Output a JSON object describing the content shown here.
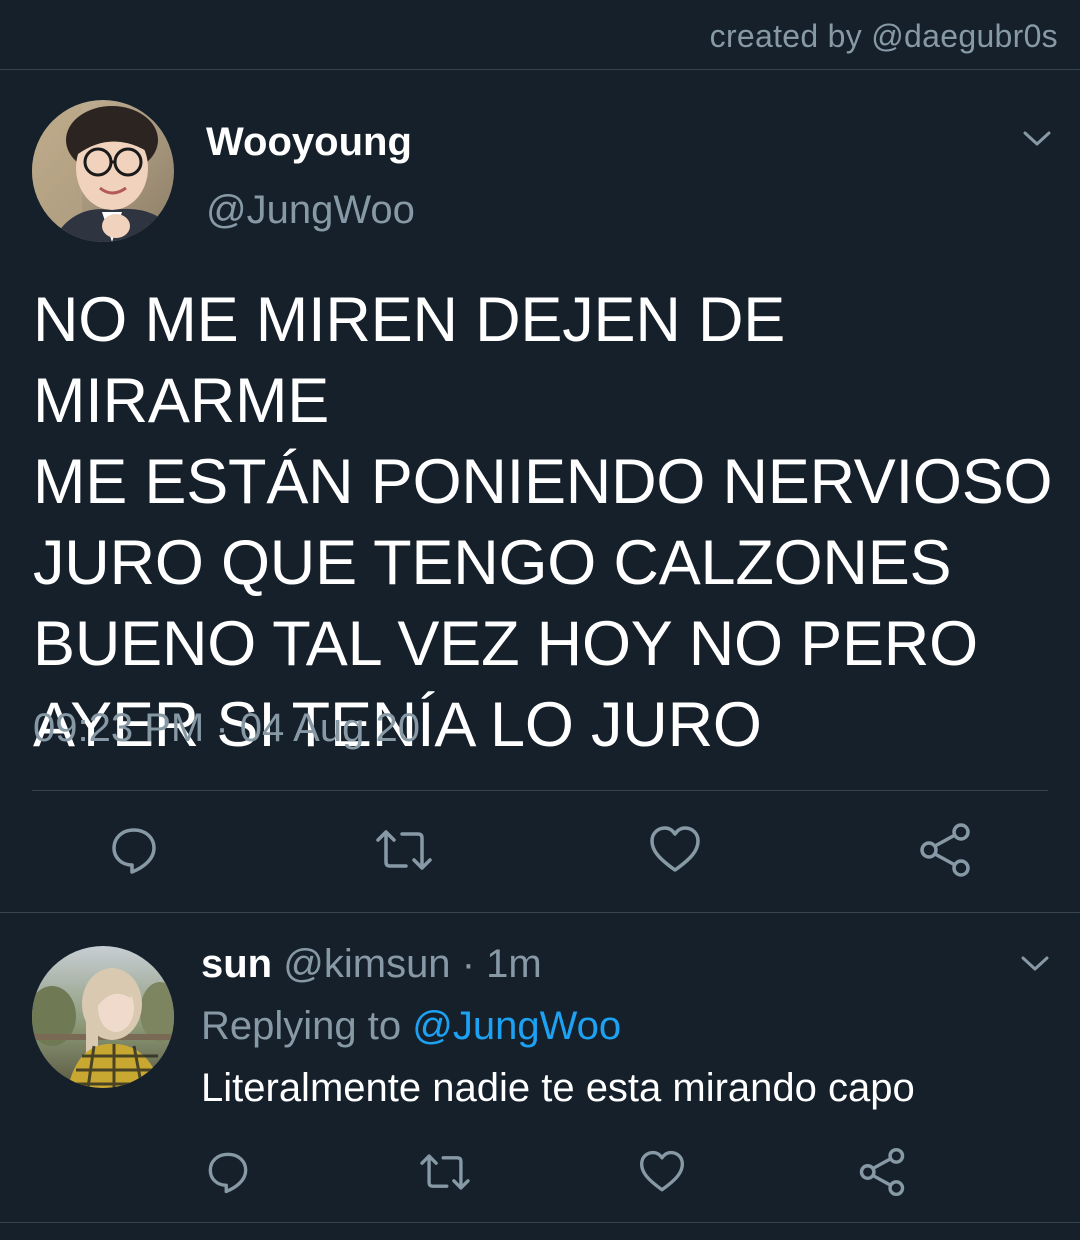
{
  "credit": "created by @daegubr0s",
  "tweet": {
    "author_name": "Wooyoung",
    "author_handle": "@JungWoo",
    "text": "NO ME MIREN DEJEN DE MIRARME\nME ESTÁN PONIENDO NERVIOSO\nJURO QUE TENGO CALZONES\nBUENO TAL VEZ HOY NO PERO\nAYER SI TENÍA LO JURO",
    "timestamp": "09:23 PM · 04 Aug 20",
    "actions": [
      "reply-icon",
      "retweet-icon",
      "like-icon",
      "share-icon"
    ]
  },
  "reply": {
    "author_name": "sun",
    "author_handle": "@kimsun",
    "separator": "·",
    "time": "1m",
    "replying_prefix": "Replying to",
    "replying_mention": "@JungWoo",
    "text": "Literalmente nadie te esta mirando capo",
    "actions": [
      "reply-icon",
      "retweet-icon",
      "like-icon",
      "share-icon"
    ]
  },
  "colors": {
    "background": "#15202b",
    "secondary_text": "#8899a6",
    "divider": "#38444d",
    "accent": "#1da1f2"
  }
}
